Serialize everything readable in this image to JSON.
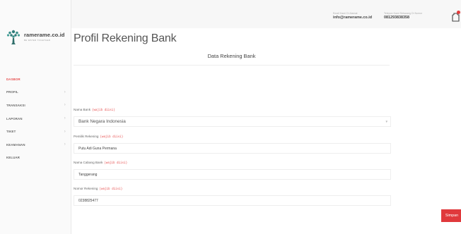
{
  "brand": {
    "name": "ramerame.co.id",
    "tagline": "BE WATER TOGETHER"
  },
  "header": {
    "email_label": "Email Kami Di Alamat",
    "email_value": "info@ramerame.co.id",
    "phone_label": "Telepon Kami Sekarang Di Nomor",
    "phone_value": "081293838358"
  },
  "sidebar": {
    "items": [
      {
        "label": "DASBOR"
      },
      {
        "label": "PROFIL"
      },
      {
        "label": "TRANSAKSI"
      },
      {
        "label": "LAPORAN"
      },
      {
        "label": "TIKET"
      },
      {
        "label": "KEAMANAN"
      },
      {
        "label": "KELUAR"
      }
    ],
    "chevron": "›"
  },
  "page": {
    "title": "Profil Rekening Bank",
    "card_title": "Data Rekening Bank"
  },
  "form": {
    "required_text": "(wajib diisi)",
    "bank_name": {
      "label": "Nama Bank",
      "value": "Bank Negara Indonesia"
    },
    "owner": {
      "label": "Pemilik Rekening",
      "value": "Putu Adi Guna Permana"
    },
    "branch": {
      "label": "Nama Cabang Bank",
      "value": "Tanggerang"
    },
    "account_number": {
      "label": "Nomor Rekening",
      "value": "0238825477"
    },
    "save_label": "Simpan"
  },
  "colors": {
    "accent": "#e0393c"
  }
}
